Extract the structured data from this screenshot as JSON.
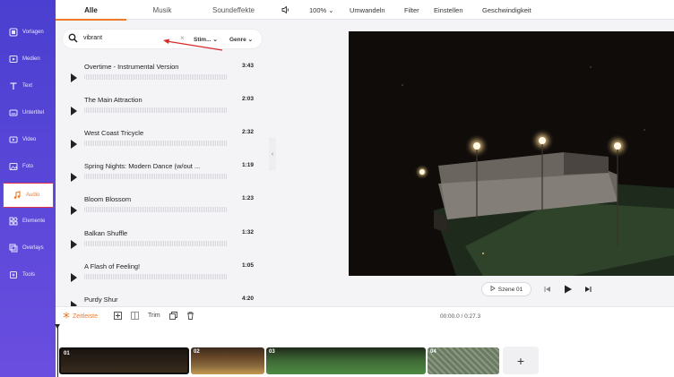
{
  "sidebar": {
    "items": [
      {
        "label": "Vorlagen",
        "icon": "template-icon"
      },
      {
        "label": "Medien",
        "icon": "media-icon"
      },
      {
        "label": "Text",
        "icon": "text-icon"
      },
      {
        "label": "Untertitel",
        "icon": "subtitle-icon"
      },
      {
        "label": "Video",
        "icon": "video-icon"
      },
      {
        "label": "Foto",
        "icon": "photo-icon"
      },
      {
        "label": "Audio",
        "icon": "music-note-icon",
        "active": true
      },
      {
        "label": "Elemente",
        "icon": "elements-icon"
      },
      {
        "label": "Overlays",
        "icon": "overlays-icon"
      },
      {
        "label": "Tools",
        "icon": "tools-icon"
      }
    ]
  },
  "panel": {
    "tabs": [
      "Alle",
      "Musik",
      "Soundeffekte"
    ],
    "active_tab": "Alle",
    "search": {
      "value": "vibrant",
      "mood_filter": "Stim...",
      "genre_filter": "Genre"
    },
    "tracks": [
      {
        "name": "Overtime - Instrumental Version",
        "duration": "3:43"
      },
      {
        "name": "The Main Attraction",
        "duration": "2:03"
      },
      {
        "name": "West Coast Tricycle",
        "duration": "2:32"
      },
      {
        "name": "Spring Nights: Modern Dance (w/out ...",
        "duration": "1:19"
      },
      {
        "name": "Bloom Blossom",
        "duration": "1:23"
      },
      {
        "name": "Balkan Shuffle",
        "duration": "1:32"
      },
      {
        "name": "A Flash of Feeling!",
        "duration": "1:05"
      },
      {
        "name": "Purdy Shur",
        "duration": "4:20"
      }
    ]
  },
  "toolbar": {
    "zoom": "100%",
    "convert": "Umwandeln",
    "filter": "Filter",
    "settings": "Einstellen",
    "speed": "Geschwindigkeit"
  },
  "preview": {
    "scene_label": "Szene 01"
  },
  "timeline": {
    "label": "Zeitleiste",
    "trim": "Trim",
    "time": "00:00.0 / 0:27.3",
    "clips": [
      "01",
      "02",
      "03",
      "04"
    ],
    "add": "+"
  },
  "colors": {
    "accent": "#f07a2a",
    "sidebar": "#5144d6",
    "highlight": "#e0334c"
  }
}
